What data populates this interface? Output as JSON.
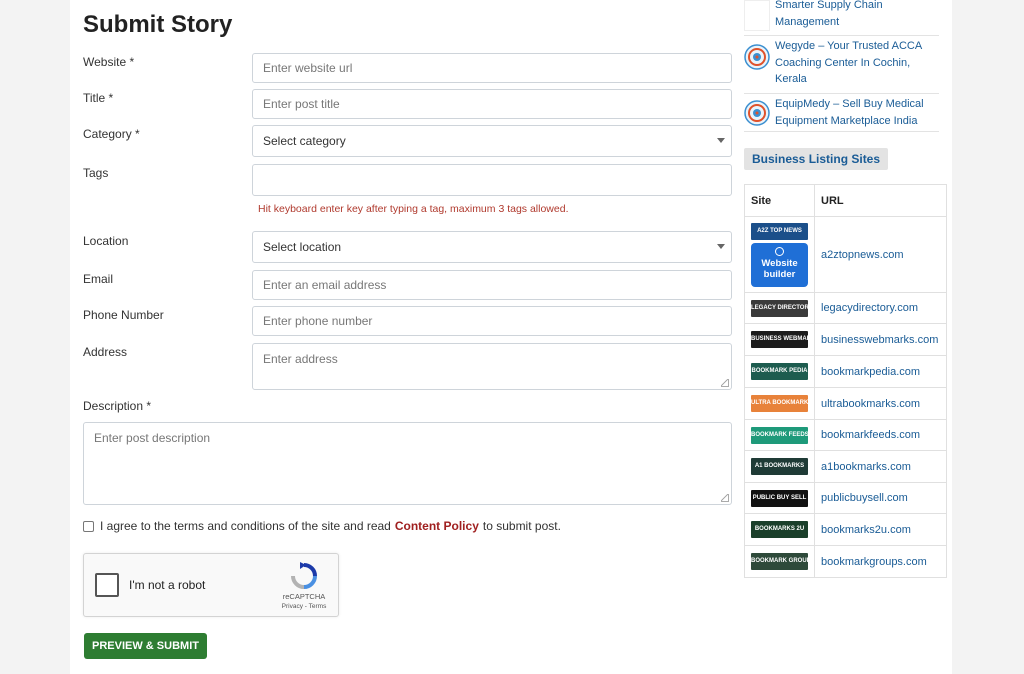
{
  "form": {
    "title": "Submit Story",
    "website_label": "Website *",
    "website_placeholder": "Enter website url",
    "title_label": "Title *",
    "title_placeholder": "Enter post title",
    "category_label": "Category *",
    "category_value": "Select category",
    "tags_label": "Tags",
    "tags_hint": "Hit keyboard enter key after typing a tag, maximum 3 tags allowed.",
    "location_label": "Location",
    "location_value": "Select location",
    "email_label": "Email",
    "email_placeholder": "Enter an email address",
    "phone_label": "Phone Number",
    "phone_placeholder": "Enter phone number",
    "address_label": "Address",
    "address_placeholder": "Enter address",
    "description_label": "Description *",
    "description_placeholder": "Enter post description",
    "agree_before": "I agree to the terms and conditions of the site and read",
    "agree_link": "Content Policy",
    "agree_after": "to submit post.",
    "captcha_text": "I'm not a robot",
    "captcha_brand": "reCAPTCHA",
    "captcha_links": "Privacy - Terms",
    "submit_label": "PREVIEW & SUBMIT"
  },
  "sidebar": {
    "recent_posts": [
      {
        "title": "Smarter Supply Chain Management"
      },
      {
        "title": "Wegyde – Your Trusted ACCA Coaching Center In Cochin, Kerala"
      },
      {
        "title": "EquipMedy – Sell Buy Medical Equipment Marketplace India"
      }
    ],
    "listing_title": "Business Listing Sites",
    "table_headers": {
      "site": "Site",
      "url": "URL"
    },
    "sites": [
      {
        "logo_text": "A2Z TOP NEWS",
        "website_builder": "Website builder",
        "url": "a2ztopnews.com",
        "color": "#1b4f8a"
      },
      {
        "logo_text": "LEGACY DIRECTORIES",
        "url": "legacydirectory.com",
        "color": "#3a3a3a"
      },
      {
        "logo_text": "BUSINESS WEBMARKS",
        "url": "businesswebmarks.com",
        "color": "#1c1c1c"
      },
      {
        "logo_text": "BOOKMARK PEDIA",
        "url": "bookmarkpedia.com",
        "color": "#1d5c4f"
      },
      {
        "logo_text": "ULTRA BOOKMARKS",
        "url": "ultrabookmarks.com",
        "color": "#e8823a"
      },
      {
        "logo_text": "BOOKMARK FEEDS",
        "url": "bookmarkfeeds.com",
        "color": "#1e9a7a"
      },
      {
        "logo_text": "A1 BOOKMARKS",
        "url": "a1bookmarks.com",
        "color": "#1f3b36"
      },
      {
        "logo_text": "PUBLIC BUY SELL",
        "url": "publicbuysell.com",
        "color": "#111111"
      },
      {
        "logo_text": "BOOKMARKS 2U",
        "url": "bookmarks2u.com",
        "color": "#1a3f2a"
      },
      {
        "logo_text": "BOOKMARK GROUPS",
        "url": "bookmarkgroups.com",
        "color": "#2e4a3a"
      }
    ]
  }
}
